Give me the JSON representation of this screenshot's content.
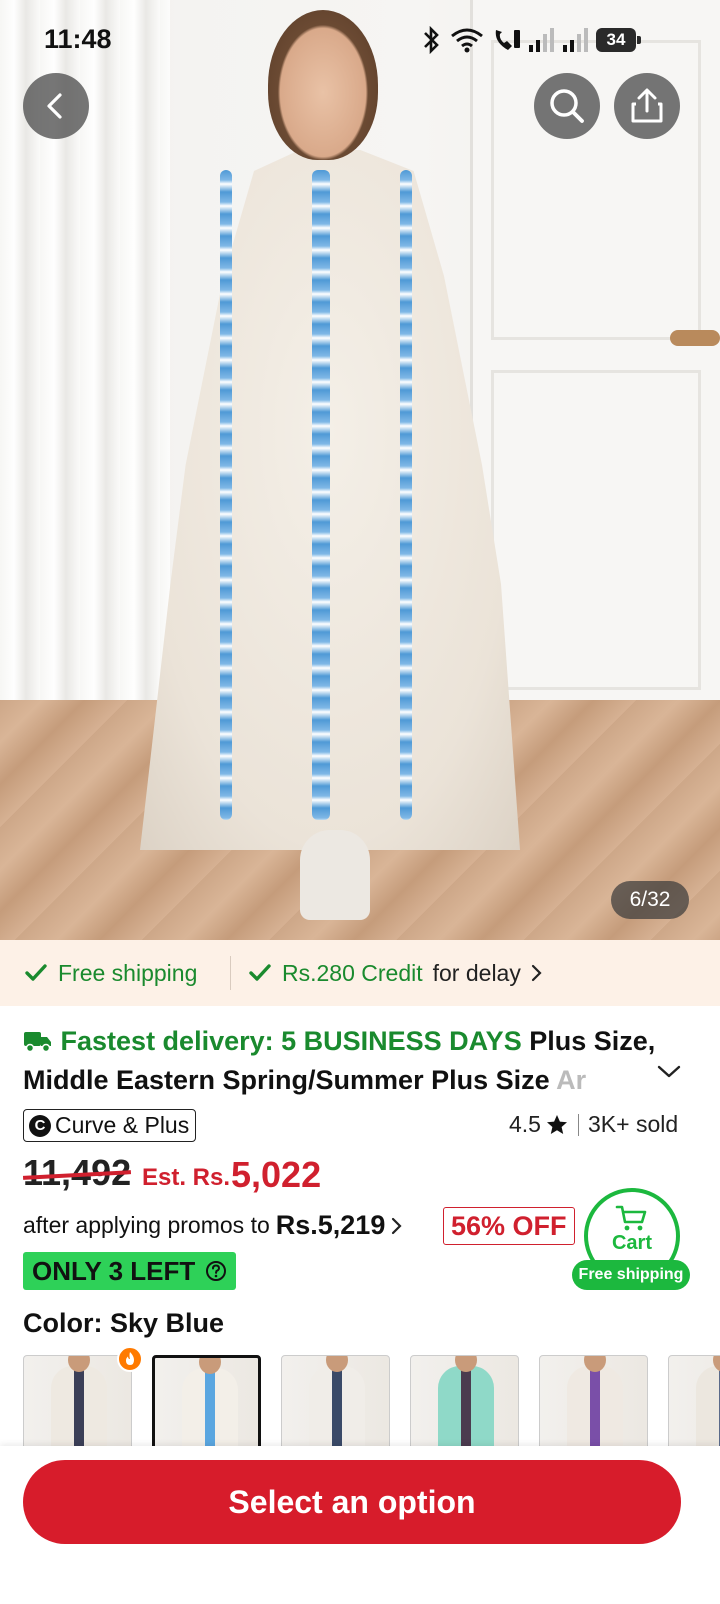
{
  "status_bar": {
    "time": "11:48",
    "battery": "34"
  },
  "gallery": {
    "counter": "6/32"
  },
  "shipping_strip": {
    "free_shipping": "Free shipping",
    "credit_amount": "Rs.280 Credit",
    "credit_suffix": "for delay"
  },
  "product": {
    "fast_delivery": "Fastest delivery: 5 BUSINESS DAYS",
    "title_line1_rest": "Plus Size,",
    "title_line2": "Middle Eastern Spring/Summer Plus Size ",
    "title_fade": "Ar",
    "brand": "Curve & Plus",
    "brand_letter": "C",
    "rating": "4.5",
    "sold": "3K+ sold"
  },
  "price": {
    "original": "11,492",
    "est_label": "Est. Rs.",
    "est_value": "5,022",
    "promo_prefix": "after applying promos to",
    "promo_value": "Rs.5,219",
    "discount": "56% OFF",
    "stock": "ONLY 3 LEFT"
  },
  "cart": {
    "label": "Cart",
    "shipping": "Free shipping"
  },
  "color": {
    "label": "Color: Sky Blue",
    "swatches": [
      {
        "trim": "#3b3f57"
      },
      {
        "trim": "#5aa6e0"
      },
      {
        "trim": "#3a4a68"
      },
      {
        "trim": "#4b3b4f"
      },
      {
        "trim": "#7a4fa8"
      },
      {
        "trim": "#5a6a8a"
      }
    ]
  },
  "colors": {
    "accent_red": "#d71c2b",
    "accent_green": "#1cb83e",
    "text_green": "#1a8a2e"
  },
  "actions": {
    "select_option": "Select an option"
  }
}
